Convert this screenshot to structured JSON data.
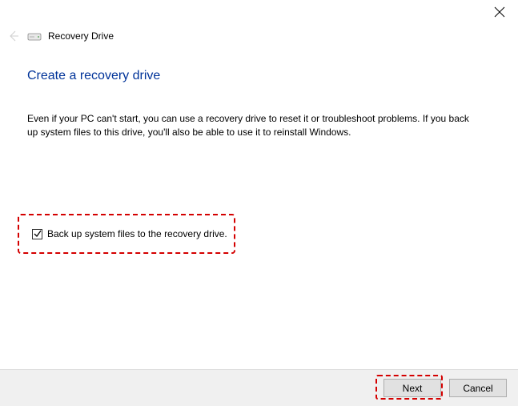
{
  "window": {
    "title": "Recovery Drive"
  },
  "page": {
    "heading": "Create a recovery drive",
    "body": "Even if your PC can't start, you can use a recovery drive to reset it or troubleshoot problems. If you back up system files to this drive, you'll also be able to use it to reinstall Windows."
  },
  "checkbox": {
    "label": "Back up system files to the recovery drive.",
    "checked": true
  },
  "buttons": {
    "next": "Next",
    "cancel": "Cancel"
  }
}
